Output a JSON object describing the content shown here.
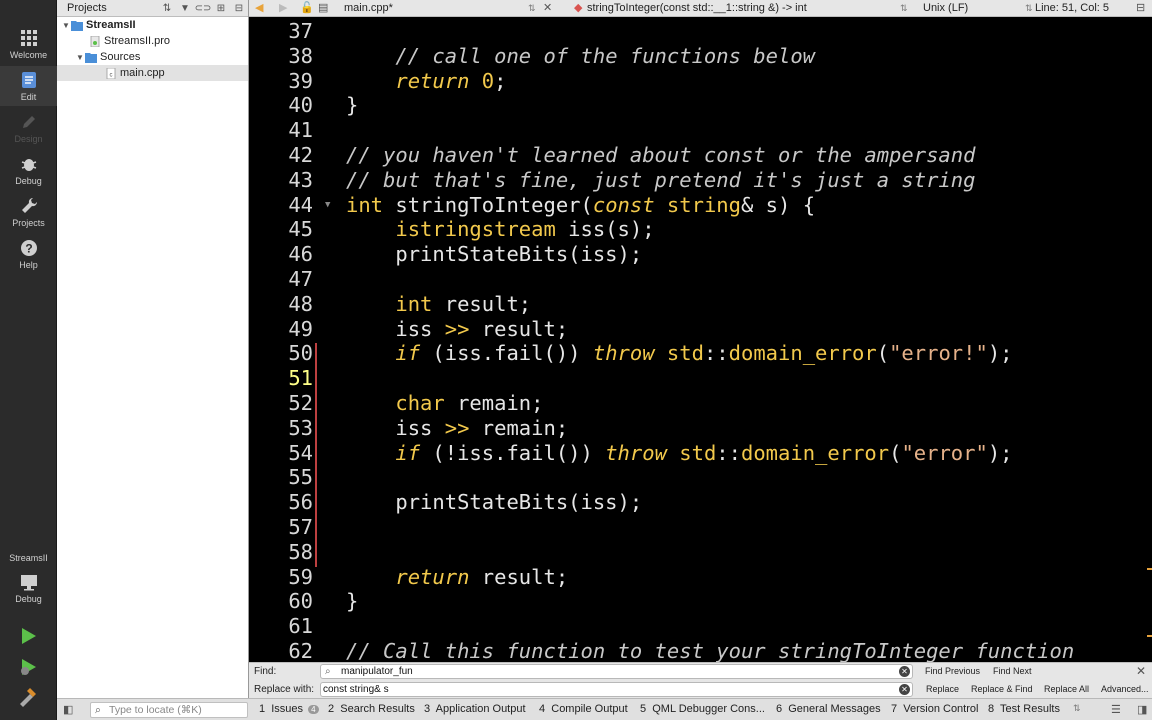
{
  "modes": [
    {
      "label": "Welcome",
      "active": false
    },
    {
      "label": "Edit",
      "active": true
    },
    {
      "label": "Design",
      "active": false,
      "disabled": true
    },
    {
      "label": "Debug",
      "active": false
    },
    {
      "label": "Projects",
      "active": false
    },
    {
      "label": "Help",
      "active": false
    }
  ],
  "kit": {
    "project": "StreamsII",
    "config": "Debug"
  },
  "projects_panel": {
    "title": "Projects",
    "tree": [
      {
        "label": "StreamsII",
        "level": 0,
        "expanded": true,
        "bold": true
      },
      {
        "label": "StreamsII.pro",
        "level": 1
      },
      {
        "label": "Sources",
        "level": 1,
        "expanded": true
      },
      {
        "label": "main.cpp",
        "level": 2,
        "selected": true
      }
    ]
  },
  "toolbar": {
    "file": "main.cpp*",
    "function": "stringToInteger(const std::__1::string &) -> int",
    "line_endings": "Unix (LF)",
    "position": "Line: 51, Col: 5"
  },
  "editor": {
    "current_line": 51,
    "lines": [
      {
        "n": 37,
        "html": ""
      },
      {
        "n": 38,
        "html": "    <span class='cm'>// call one of the functions below</span>"
      },
      {
        "n": 39,
        "html": "    <span class='kwi'>return</span> <span class='num'>0</span>;"
      },
      {
        "n": 40,
        "html": "}"
      },
      {
        "n": 41,
        "html": ""
      },
      {
        "n": 42,
        "html": "<span class='cm'>// you haven't learned about const or the ampersand</span>"
      },
      {
        "n": 43,
        "html": "<span class='cm'>// but that's fine, just pretend it's just a string</span>"
      },
      {
        "n": 44,
        "html": "<span class='type'>int</span> stringToInteger(<span class='kwi'>const</span> <span class='type'>string</span>&amp; s) {"
      },
      {
        "n": 45,
        "html": "    <span class='type'>istringstream</span> iss(s);"
      },
      {
        "n": 46,
        "html": "    printStateBits(iss);"
      },
      {
        "n": 47,
        "html": ""
      },
      {
        "n": 48,
        "html": "    <span class='type'>int</span> result;"
      },
      {
        "n": 49,
        "html": "    iss <span class='type'>&gt;&gt;</span> result;"
      },
      {
        "n": 50,
        "html": "    <span class='kwi'>if</span> (iss.fail()) <span class='kwi'>throw</span> <span class='type'>std</span>::<span class='type'>domain_error</span>(<span class='str'>\"error!\"</span>);"
      },
      {
        "n": 51,
        "html": ""
      },
      {
        "n": 52,
        "html": "    <span class='type'>char</span> remain;"
      },
      {
        "n": 53,
        "html": "    iss <span class='type'>&gt;&gt;</span> remain;"
      },
      {
        "n": 54,
        "html": "    <span class='kwi'>if</span> (!iss.fail()) <span class='kwi'>throw</span> <span class='type'>std</span>::<span class='type'>domain_error</span>(<span class='str'>\"error\"</span>);"
      },
      {
        "n": 55,
        "html": ""
      },
      {
        "n": 56,
        "html": "    printStateBits(iss);"
      },
      {
        "n": 57,
        "html": ""
      },
      {
        "n": 58,
        "html": ""
      },
      {
        "n": 59,
        "html": "    <span class='kwi'>return</span> result;"
      },
      {
        "n": 60,
        "html": "}"
      },
      {
        "n": 61,
        "html": ""
      },
      {
        "n": 62,
        "html": "<span class='cm'>// Call this function to test your stringToInteger function</span>"
      }
    ]
  },
  "findbar": {
    "find_label": "Find:",
    "find_value": "manipulator_fun",
    "replace_label": "Replace with:",
    "replace_value": "const string& s",
    "find_previous": "Find Previous",
    "find_next": "Find Next",
    "replace": "Replace",
    "replace_find": "Replace & Find",
    "replace_all": "Replace All",
    "advanced": "Advanced..."
  },
  "bottombar": {
    "locator_placeholder": "Type to locate (⌘K)",
    "panes": [
      {
        "num": "1",
        "label": "Issues",
        "badge": "4"
      },
      {
        "num": "2",
        "label": "Search Results"
      },
      {
        "num": "3",
        "label": "Application Output"
      },
      {
        "num": "4",
        "label": "Compile Output"
      },
      {
        "num": "5",
        "label": "QML Debugger Cons..."
      },
      {
        "num": "6",
        "label": "General Messages"
      },
      {
        "num": "7",
        "label": "Version Control"
      },
      {
        "num": "8",
        "label": "Test Results"
      }
    ]
  }
}
